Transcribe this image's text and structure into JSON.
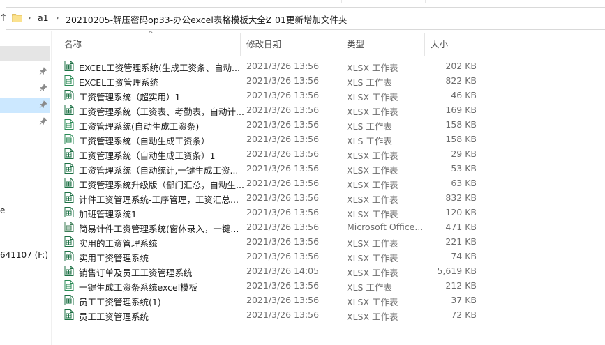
{
  "address_bar": {
    "breadcrumbs": [
      "a1",
      "20210205-解压密码op33-办公excel表格模板大全Z",
      "01更新增加文件夹"
    ],
    "separator": "›"
  },
  "nav_pane": {
    "items": [
      {
        "label": "e"
      },
      {
        "label": "641107 (F:)"
      }
    ]
  },
  "columns": {
    "name": "名称",
    "date": "修改日期",
    "type": "类型",
    "size": "大小"
  },
  "files": [
    {
      "name": "EXCEL工资管理系统(生成工资条、自动...",
      "date": "2021/3/26 13:56",
      "type": "XLSX 工作表",
      "size": "202 KB",
      "icon": "xlsx-file-icon"
    },
    {
      "name": "EXCEL工资管理系统",
      "date": "2021/3/26 13:56",
      "type": "XLS 工作表",
      "size": "822 KB",
      "icon": "xls-file-icon"
    },
    {
      "name": "工资管理系统（超实用）1",
      "date": "2021/3/26 13:56",
      "type": "XLSX 工作表",
      "size": "46 KB",
      "icon": "xlsx-file-icon"
    },
    {
      "name": "工资管理系统（工资表、考勤表，自动计...",
      "date": "2021/3/26 13:56",
      "type": "XLSX 工作表",
      "size": "169 KB",
      "icon": "xlsx-file-icon"
    },
    {
      "name": "工资管理系统(自动生成工资条)",
      "date": "2021/3/26 13:56",
      "type": "XLS 工作表",
      "size": "158 KB",
      "icon": "xls-file-icon"
    },
    {
      "name": "工资管理系统（自动生成工资条）",
      "date": "2021/3/26 13:56",
      "type": "XLS 工作表",
      "size": "158 KB",
      "icon": "xls-file-icon"
    },
    {
      "name": "工资管理系统（自动生成工资条）1",
      "date": "2021/3/26 13:56",
      "type": "XLSX 工作表",
      "size": "29 KB",
      "icon": "xlsx-file-icon"
    },
    {
      "name": "工资管理系统（自动统计,一键生成工资...",
      "date": "2021/3/26 13:56",
      "type": "XLSX 工作表",
      "size": "53 KB",
      "icon": "xlsx-file-icon"
    },
    {
      "name": "工资管理系统升级版（部门汇总，自动生...",
      "date": "2021/3/26 13:56",
      "type": "XLSX 工作表",
      "size": "63 KB",
      "icon": "xlsx-file-icon"
    },
    {
      "name": "计件工资管理系统-工序管理，工资汇总...",
      "date": "2021/3/26 13:56",
      "type": "XLSX 工作表",
      "size": "832 KB",
      "icon": "xlsx-file-icon"
    },
    {
      "name": "加班管理系统1",
      "date": "2021/3/26 13:56",
      "type": "XLSX 工作表",
      "size": "120 KB",
      "icon": "xlsx-file-icon"
    },
    {
      "name": "简易计件工资管理系统(窗体录入，一键...",
      "date": "2021/3/26 13:56",
      "type": "Microsoft Office...",
      "size": "471 KB",
      "icon": "xlsm-file-icon"
    },
    {
      "name": "实用的工资管理系统",
      "date": "2021/3/26 13:56",
      "type": "XLSX 工作表",
      "size": "221 KB",
      "icon": "xlsx-file-icon"
    },
    {
      "name": "实用工资管理系统",
      "date": "2021/3/26 13:56",
      "type": "XLSX 工作表",
      "size": "74 KB",
      "icon": "xlsx-file-icon"
    },
    {
      "name": "销售订单及员工工资管理系统",
      "date": "2021/3/26 14:05",
      "type": "XLSX 工作表",
      "size": "5,619 KB",
      "icon": "xlsx-file-icon"
    },
    {
      "name": "一键生成工资条系统excel模板",
      "date": "2021/3/26 13:56",
      "type": "XLS 工作表",
      "size": "212 KB",
      "icon": "xls-file-icon"
    },
    {
      "name": "员工工资管理系统(1)",
      "date": "2021/3/26 13:56",
      "type": "XLSX 工作表",
      "size": "37 KB",
      "icon": "xlsx-file-icon"
    },
    {
      "name": "员工工资管理系统",
      "date": "2021/3/26 13:56",
      "type": "XLSX 工作表",
      "size": "72 KB",
      "icon": "xlsx-file-icon"
    }
  ],
  "colors": {
    "excel_green": "#1d7044",
    "selection_blue": "#cce8ff",
    "hover_gray": "#e5e5e5",
    "folder_yellow": "#f8d775"
  }
}
